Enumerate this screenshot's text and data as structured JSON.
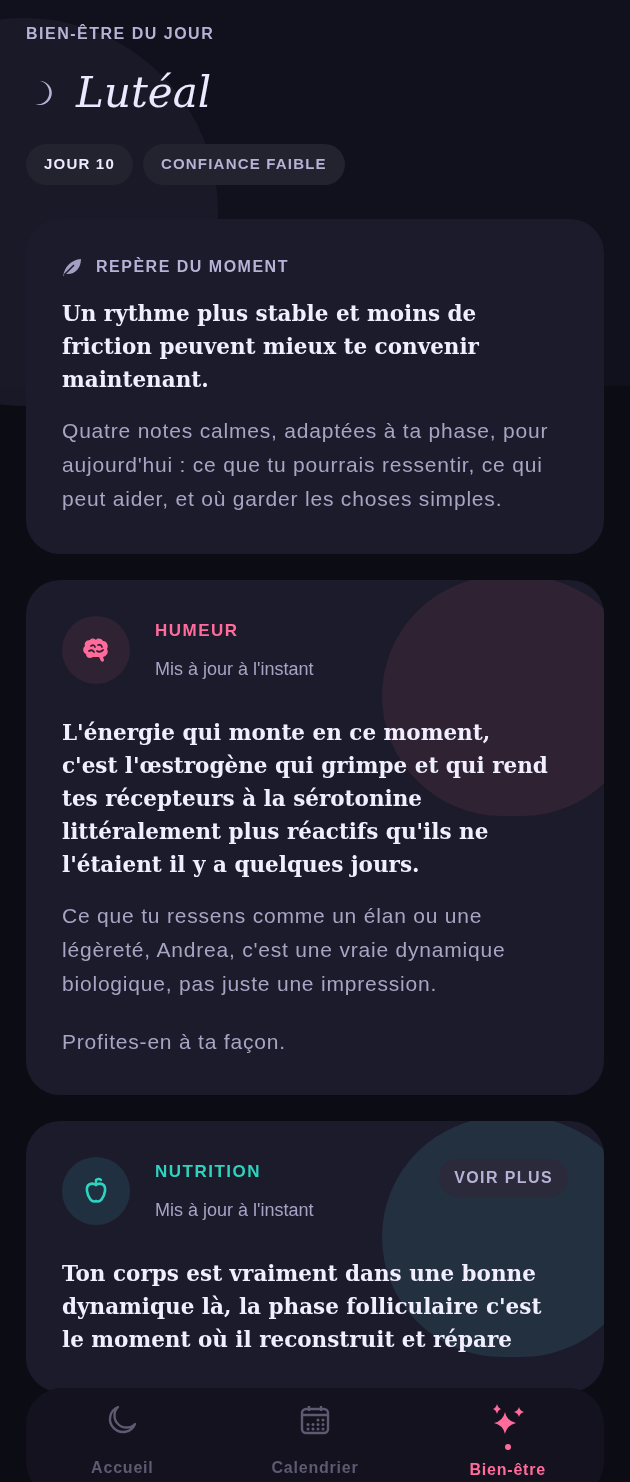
{
  "header": {
    "eyebrow": "BIEN-ÊTRE DU JOUR",
    "phase": "Lutéal",
    "chips": [
      {
        "kind": "day",
        "label": "JOUR 10"
      },
      {
        "kind": "confidence",
        "label": "CONFIANCE FAIBLE"
      }
    ]
  },
  "cards": [
    {
      "kind": "intro",
      "label": "REPÈRE DU MOMENT",
      "headline": "Un rythme plus stable et moins de friction peuvent mieux te convenir maintenant.",
      "paragraphs": [
        "Quatre notes calmes, adaptées à ta phase, pour aujourd'hui : ce que tu pourrais ressentir, ce qui peut aider, et où garder les choses simples."
      ]
    },
    {
      "kind": "mood",
      "label": "HUMEUR",
      "color": "#ff6b9a",
      "updated": "Mis à jour à l'instant",
      "headline": "L'énergie qui monte en ce moment, c'est l'œstrogène qui grimpe et qui rend tes récepteurs à la sérotonine littéralement plus réactifs qu'ils ne l'étaient il y a quelques jours.",
      "paragraphs": [
        "Ce que tu ressens comme un élan ou une légèreté, Andrea, c'est une vraie dynamique biologique, pas juste une impression.",
        "Profites-en à ta façon."
      ]
    },
    {
      "kind": "nutrition",
      "label": "NUTRITION",
      "color": "#2dd4bf",
      "updated": "Mis à jour à l'instant",
      "more": "VOIR PLUS",
      "headline": "Ton corps est vraiment dans une bonne dynamique là, la phase folliculaire c'est le moment où il reconstruit et répare"
    }
  ],
  "nav": [
    {
      "kind": "home",
      "label": "Accueil",
      "selected": false
    },
    {
      "kind": "calendar",
      "label": "Calendrier",
      "selected": false
    },
    {
      "kind": "wellbeing",
      "label": "Bien-être",
      "selected": true
    }
  ]
}
